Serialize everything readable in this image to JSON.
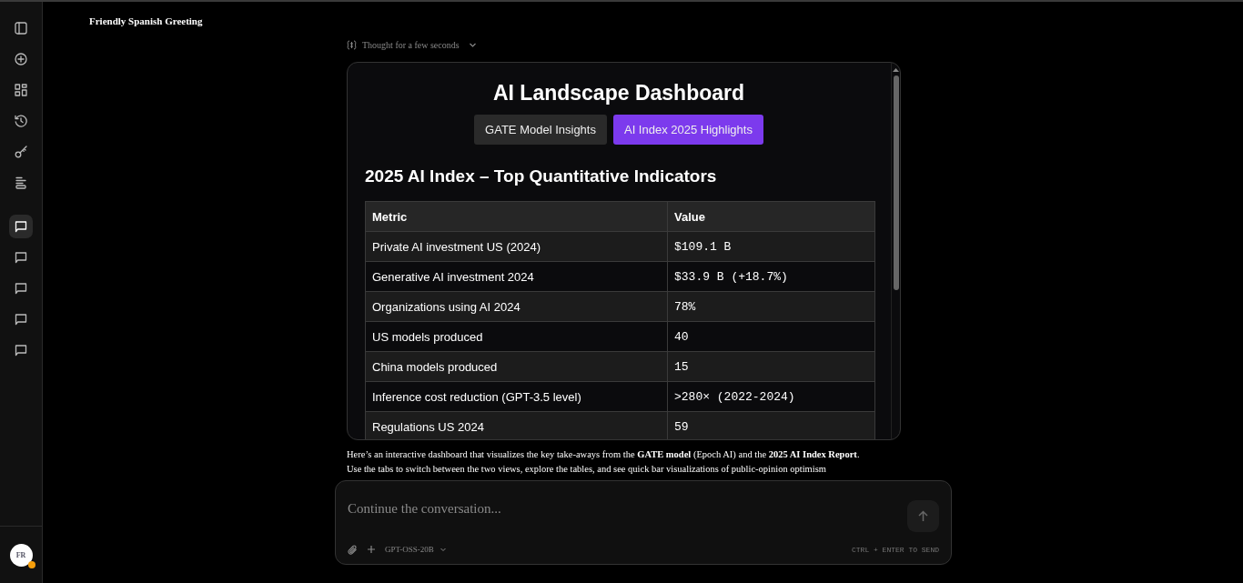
{
  "conversation_title": "Friendly Spanish Greeting",
  "sidebar": {
    "conversations": [
      {
        "selected": true
      },
      {
        "selected": false
      },
      {
        "selected": false
      },
      {
        "selected": false
      },
      {
        "selected": false
      }
    ],
    "avatar": {
      "initials": "FR",
      "color": "#f59e0b"
    }
  },
  "thought": {
    "label": "Thought for a few seconds",
    "expanded": false
  },
  "dashboard": {
    "title": "AI Landscape Dashboard",
    "tabs": [
      {
        "label": "GATE Model Insights",
        "selected": false
      },
      {
        "label": "AI Index 2025 Highlights",
        "selected": true
      }
    ],
    "heading": "2025 AI Index – Top Quantitative Indicators",
    "table": {
      "columns": [
        "Metric",
        "Value"
      ],
      "rows": [
        [
          "Private AI investment US (2024)",
          "$109.1 B"
        ],
        [
          "Generative AI investment 2024",
          "$33.9 B (+18.7%)"
        ],
        [
          "Organizations using AI 2024",
          "78%"
        ],
        [
          "US models produced",
          "40"
        ],
        [
          "China models produced",
          "15"
        ],
        [
          "Inference cost reduction (GPT-3.5 level)",
          ">280× (2022-2024)"
        ],
        [
          "Regulations US 2024",
          "59"
        ]
      ]
    }
  },
  "message": [
    "Here’s an interactive dashboard that visualizes the key take-aways from the **GATE model** (Epoch AI) and the **2025 AI Index Report**.",
    "Use the tabs to switch between the two views, explore the tables, and see quick bar visualizations of public-opinion optimism"
  ],
  "composer": {
    "placeholder": "Continue the conversation...",
    "model": "GPT-OSS-20B",
    "hint": "CTRL + ENTER TO SEND"
  }
}
